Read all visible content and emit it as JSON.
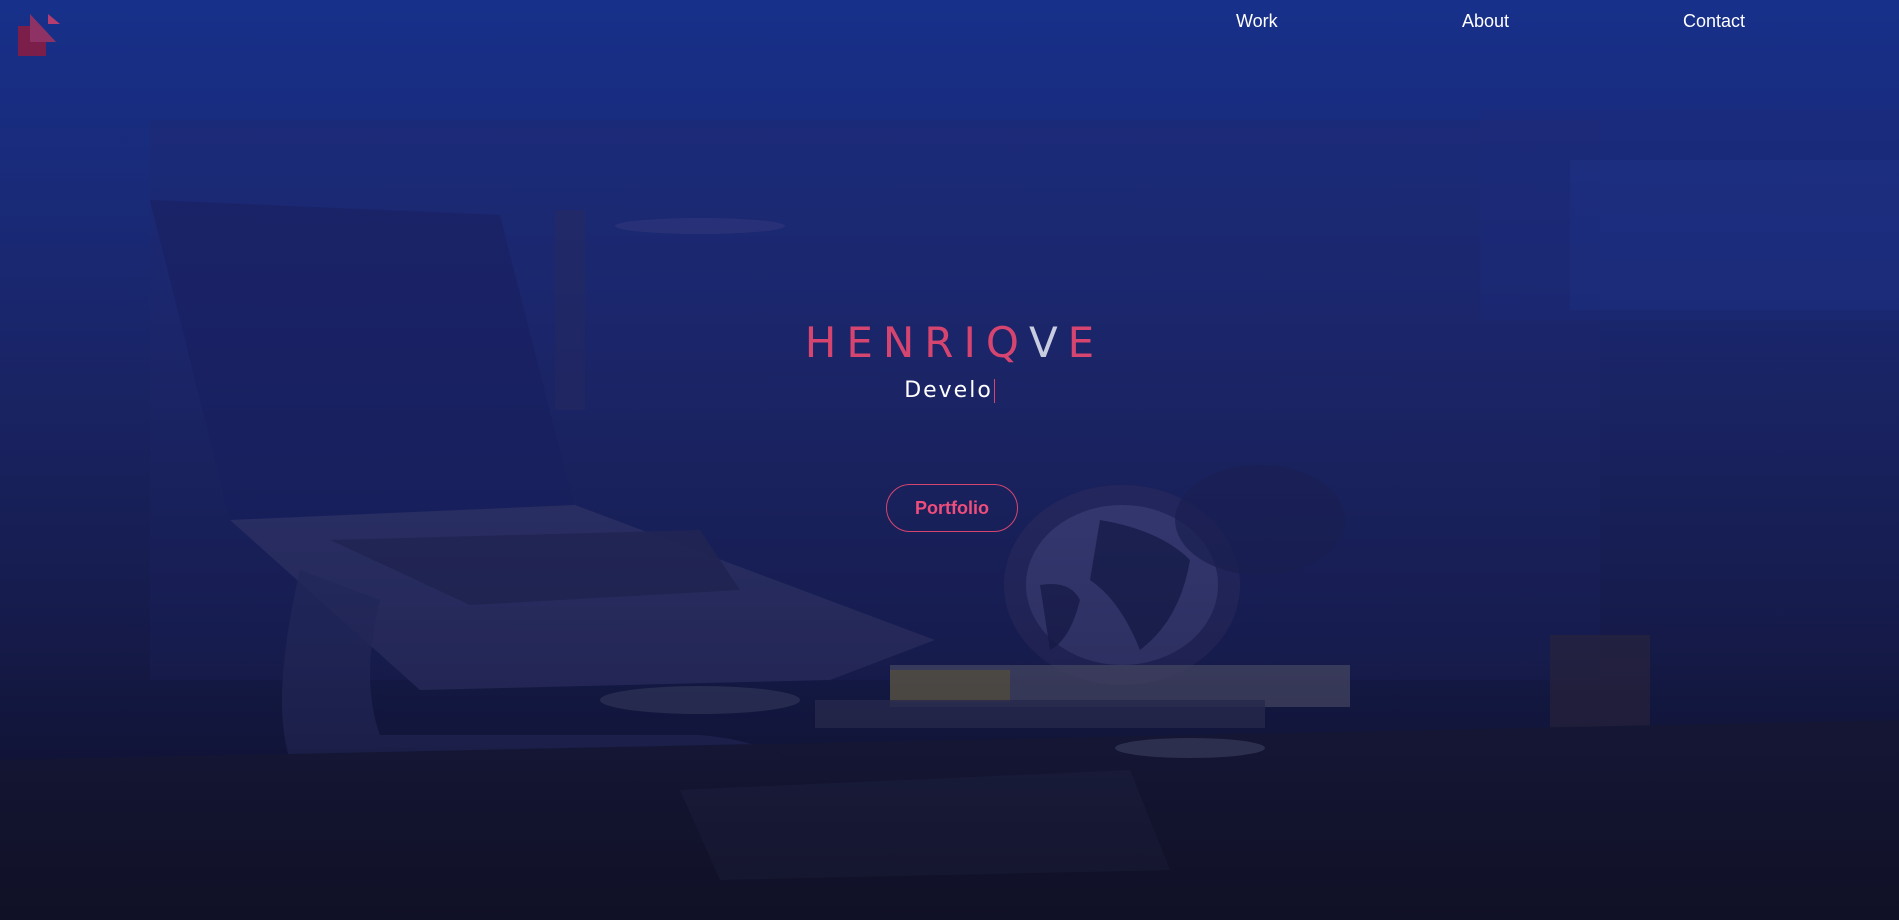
{
  "nav": {
    "logo_icon": "brand-logo-icon",
    "links": [
      {
        "label": "Work"
      },
      {
        "label": "About"
      },
      {
        "label": "Contact"
      }
    ]
  },
  "hero": {
    "title_part1": "HENRIQ",
    "title_highlight": "V",
    "title_part2": "E",
    "subtitle": "Develo",
    "button_label": "Portfolio"
  },
  "colors": {
    "accent": "#d6456f",
    "background_top": "#17308a",
    "background_bottom": "#0e0f24",
    "text": "#ffffff"
  }
}
